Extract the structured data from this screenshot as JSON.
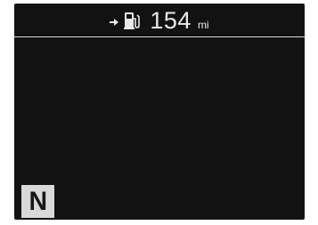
{
  "range_display": {
    "value": "154",
    "unit": "mi",
    "icons": [
      "arrow-right-icon",
      "fuel-pump-icon"
    ]
  },
  "gear_indicator": {
    "label": "N"
  },
  "colors": {
    "screen_background": "#121212",
    "text": "#e9e9e9",
    "divider": "#d9d9d9",
    "gear_box_background": "#d9d9d9",
    "gear_text": "#161616"
  }
}
